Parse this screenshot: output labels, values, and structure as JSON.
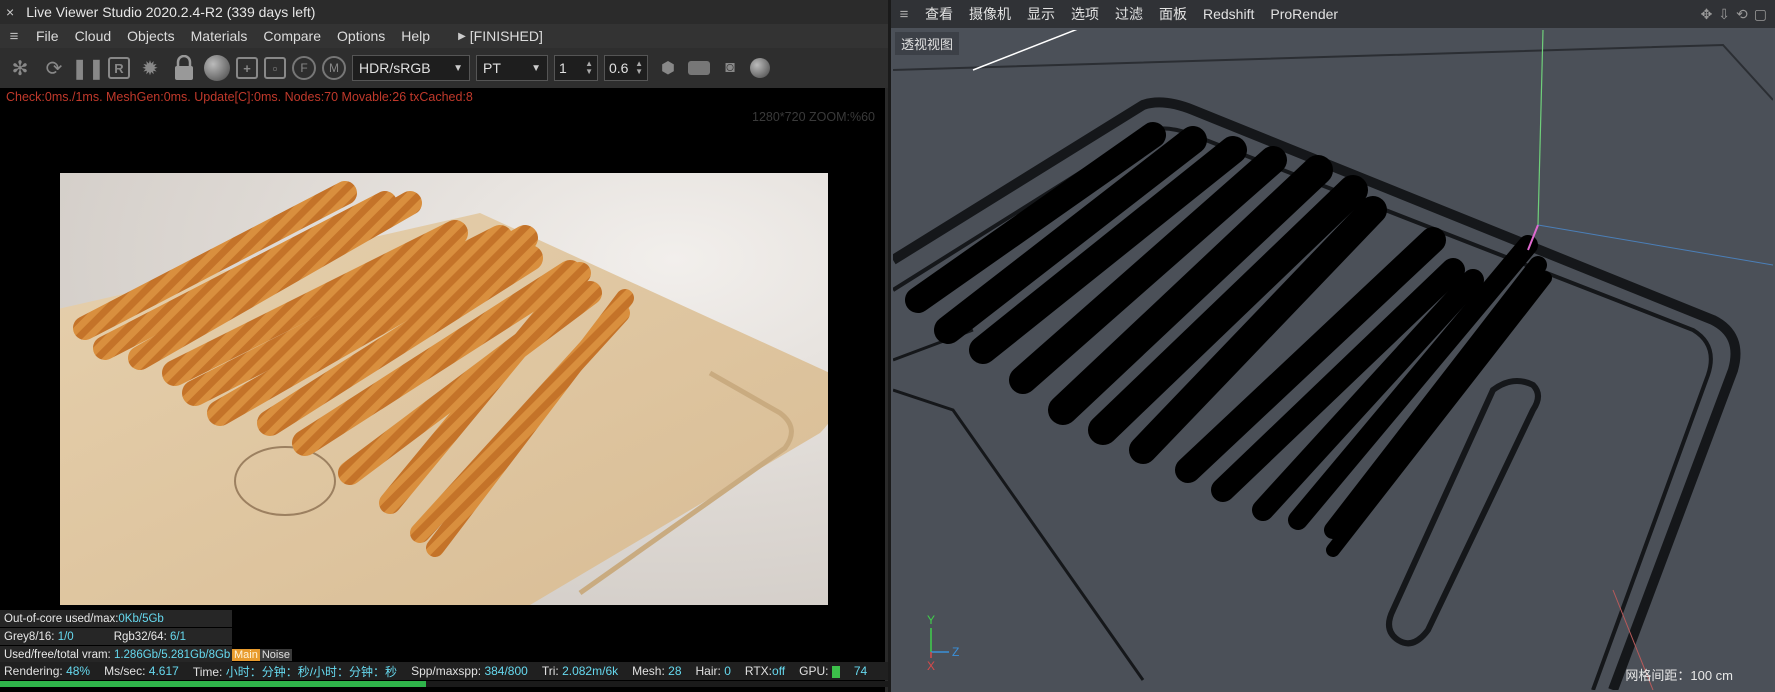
{
  "live_viewer": {
    "title_close": "×",
    "title": "Live Viewer Studio 2020.2.4-R2 (339 days left)",
    "menu": [
      "File",
      "Cloud",
      "Objects",
      "Materials",
      "Compare",
      "Options",
      "Help"
    ],
    "state": "[FINISHED]",
    "toolbar": {
      "color_space": "HDR/sRGB",
      "kernel": "PT",
      "value_a": "1",
      "value_b": "0.6",
      "icons": [
        "aperture-icon",
        "refresh-icon",
        "pause-icon",
        "region-icon",
        "settings-gear-icon",
        "lock-icon",
        "material-ball-icon",
        "add-box-icon",
        "region-select-icon",
        "focus-f-icon",
        "material-m-icon"
      ]
    },
    "status": "Check:0ms./1ms. MeshGen:0ms. Update[C]:0ms. Nodes:70 Movable:26 txCached:8",
    "resolution_zoom": "1280*720 ZOOM:%60",
    "stats": {
      "out_of_core_label": "Out-of-core used/max:",
      "out_of_core_value": "0Kb/5Gb",
      "grey_label": "Grey8/16:",
      "grey_value": "1/0",
      "rgb_label": "Rgb32/64:",
      "rgb_value": "6/1",
      "vram_label": "Used/free/total vram:",
      "vram_value": "1.286Gb/5.281Gb/8Gb",
      "tag_main": "Main",
      "tag_noise": "Noise"
    },
    "bottom": {
      "rendering_label": "Rendering:",
      "rendering_value": "48%",
      "ms_label": "Ms/sec:",
      "ms_value": "4.617",
      "time_label": "Time:",
      "time_value": "小时：分钟：秒/小时：分钟：秒",
      "spp_label": "Spp/maxspp:",
      "spp_value": "384/800",
      "tri_label": "Tri:",
      "tri_value": "2.082m/6k",
      "mesh_label": "Mesh:",
      "mesh_value": "28",
      "hair_label": "Hair:",
      "hair_value": "0",
      "rtx_label": "RTX:",
      "rtx_value": "off",
      "gpu_label": "GPU:",
      "gpu_value": "74"
    },
    "progress": 0.48
  },
  "c4d": {
    "menu": [
      "查看",
      "摄像机",
      "显示",
      "选项",
      "过滤",
      "面板",
      "Redshift",
      "ProRender"
    ],
    "nav_icons": [
      "move-view-icon",
      "down-arrow-icon",
      "rotate-icon",
      "maximize-icon"
    ],
    "viewport_label": "透视视图",
    "grid_spacing": "网格间距：100 cm",
    "axis": {
      "x": "X",
      "y": "Y",
      "z": "Z"
    }
  }
}
